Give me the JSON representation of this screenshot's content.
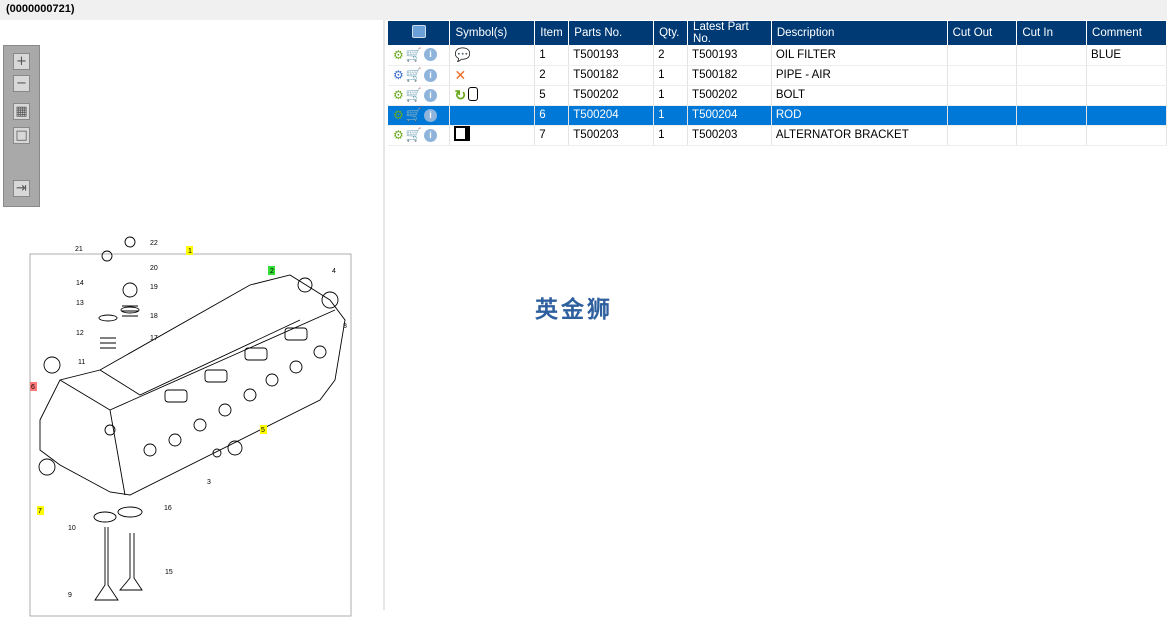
{
  "title": "(0000000721)",
  "toolbar": {
    "zoom_in": "+",
    "zoom_out": "−",
    "fit": "▦",
    "actual": "□",
    "panel": "⇥"
  },
  "columns": [
    "Symbol(s)",
    "Item",
    "Parts No.",
    "Qty.",
    "Latest Part No.",
    "Description",
    "Cut Out",
    "Cut In",
    "Comment"
  ],
  "rows": [
    {
      "item": "1",
      "part": "T500193",
      "qty": "2",
      "latest": "T500193",
      "desc": "OIL FILTER",
      "cut_out": "",
      "cut_in": "",
      "comment": "BLUE",
      "symbols": [
        "speech-warning-icon"
      ],
      "selected": false
    },
    {
      "item": "2",
      "part": "T500182",
      "qty": "1",
      "latest": "T500182",
      "desc": "PIPE - AIR",
      "cut_out": "",
      "cut_in": "",
      "comment": "",
      "symbols": [
        "cross-icon"
      ],
      "selected": false
    },
    {
      "item": "5",
      "part": "T500202",
      "qty": "1",
      "latest": "T500202",
      "desc": "BOLT",
      "cut_out": "",
      "cut_in": "",
      "comment": "",
      "symbols": [
        "refresh-icon",
        "cylinder-icon"
      ],
      "selected": false
    },
    {
      "item": "6",
      "part": "T500204",
      "qty": "1",
      "latest": "T500204",
      "desc": "ROD",
      "cut_out": "",
      "cut_in": "",
      "comment": "",
      "symbols": [],
      "selected": true
    },
    {
      "item": "7",
      "part": "T500203",
      "qty": "1",
      "latest": "T500203",
      "desc": "ALTERNATOR BRACKET",
      "cut_out": "",
      "cut_in": "",
      "comment": "",
      "symbols": [
        "document-icon"
      ],
      "selected": false
    }
  ],
  "callouts": [
    "21",
    "22",
    "1",
    "20",
    "2",
    "4",
    "14",
    "19",
    "13",
    "18",
    "8",
    "12",
    "17",
    "11",
    "6",
    "5",
    "7",
    "3",
    "16",
    "10",
    "15",
    "9"
  ],
  "watermark": "英金狮",
  "colors": {
    "header": "#003a75",
    "selected": "#0078d7",
    "callout_yellow": "#ffff00",
    "callout_green": "#33dd33",
    "callout_red": "#ff7777"
  }
}
